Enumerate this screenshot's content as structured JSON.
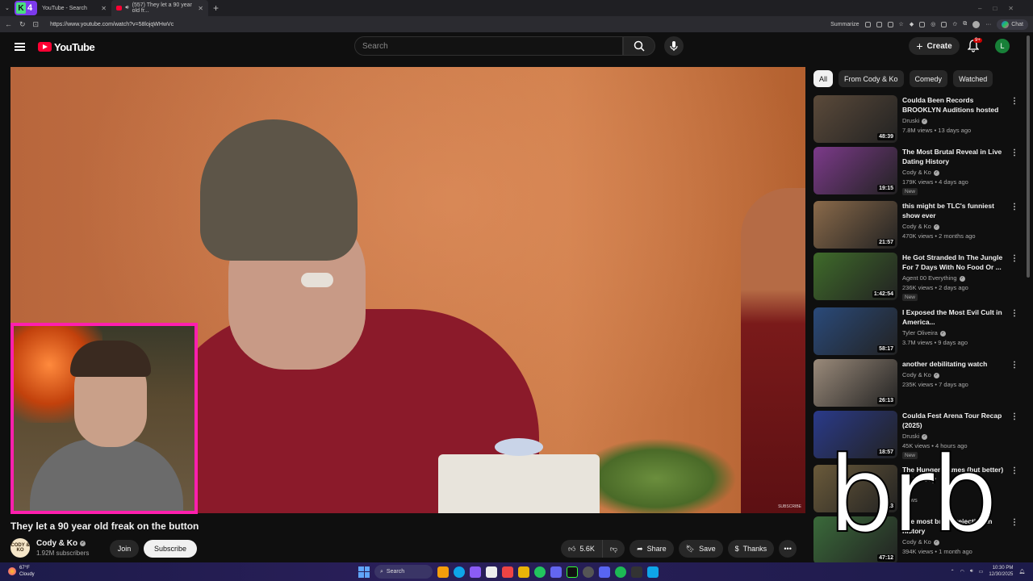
{
  "browser": {
    "tabs": [
      {
        "label": "YouTube - Search",
        "badge_letter": "K",
        "badge_number": "4"
      },
      {
        "label": "(557) They let a 90 year old fr..."
      }
    ],
    "url": "https://www.youtube.com/watch?v=58lojqWHwVc",
    "summarize_label": "Summarize",
    "chat_label": "Chat"
  },
  "youtube": {
    "logo_text": "YouTube",
    "search": {
      "placeholder": "Search"
    },
    "create_label": "Create",
    "notif_count": "9+",
    "avatar_letter": "L"
  },
  "video": {
    "title": "They let a 90 year old freak on the button",
    "watermark": "SUBSCRIBE",
    "overlay_text": "brb",
    "channel": {
      "name": "Cody & Ko",
      "avatar_text": "CODY & KO",
      "subscribers": "1.92M subscribers"
    },
    "join_label": "Join",
    "subscribe_label": "Subscribe",
    "likes": "5.6K",
    "share_label": "Share",
    "save_label": "Save",
    "thanks_label": "Thanks"
  },
  "sidebar": {
    "chips": [
      "All",
      "From Cody & Ko",
      "Comedy",
      "Watched"
    ],
    "recommendations": [
      {
        "title": "Coulda Been Records BROOKLYN Auditions hosted b...",
        "channel": "Druski",
        "meta": "7.8M views • 13 days ago",
        "duration": "48:39",
        "new": "",
        "color": "#5b4a3a"
      },
      {
        "title": "The Most Brutal Reveal in Live Dating History",
        "channel": "Cody & Ko",
        "meta": "179K views • 4 days ago",
        "duration": "19:15",
        "new": "New",
        "color": "#7c3a8a"
      },
      {
        "title": "this might be TLC's funniest show ever",
        "channel": "Cody & Ko",
        "meta": "470K views • 2 months ago",
        "duration": "21:57",
        "new": "",
        "color": "#8a6a4a"
      },
      {
        "title": "He Got Stranded In The Jungle For 7 Days With No Food Or ...",
        "channel": "Agent 00 Everything",
        "meta": "236K views • 2 days ago",
        "duration": "1:42:54",
        "new": "New",
        "color": "#3f6b2a"
      },
      {
        "title": "I Exposed the Most Evil Cult in America...",
        "channel": "Tyler Oliveira",
        "meta": "3.7M views • 9 days ago",
        "duration": "58:17",
        "new": "",
        "color": "#2a4a7a"
      },
      {
        "title": "another debilitating watch",
        "channel": "Cody & Ko",
        "meta": "235K views • 7 days ago",
        "duration": "26:13",
        "new": "",
        "color": "#9a8a7a"
      },
      {
        "title": "Coulda Fest Arena Tour Recap (2025)",
        "channel": "Druski",
        "meta": "45K views • 4 hours ago",
        "duration": "18:57",
        "new": "New",
        "color": "#2a3a8a"
      },
      {
        "title": "The Hunger Games (but better) - A Parody",
        "channel": "",
        "meta": "views",
        "duration": "13",
        "new": "",
        "color": "#6a5a3a"
      },
      {
        "title": "The most brutal rejection in history",
        "channel": "Cody & Ko",
        "meta": "394K views • 1 month ago",
        "duration": "47:12",
        "new": "",
        "color": "#3a6a3a"
      }
    ]
  },
  "taskbar": {
    "temp": "67°F",
    "weather": "Cloudy",
    "search_label": "Search",
    "time": "10:30 PM",
    "date": "12/30/2025"
  }
}
